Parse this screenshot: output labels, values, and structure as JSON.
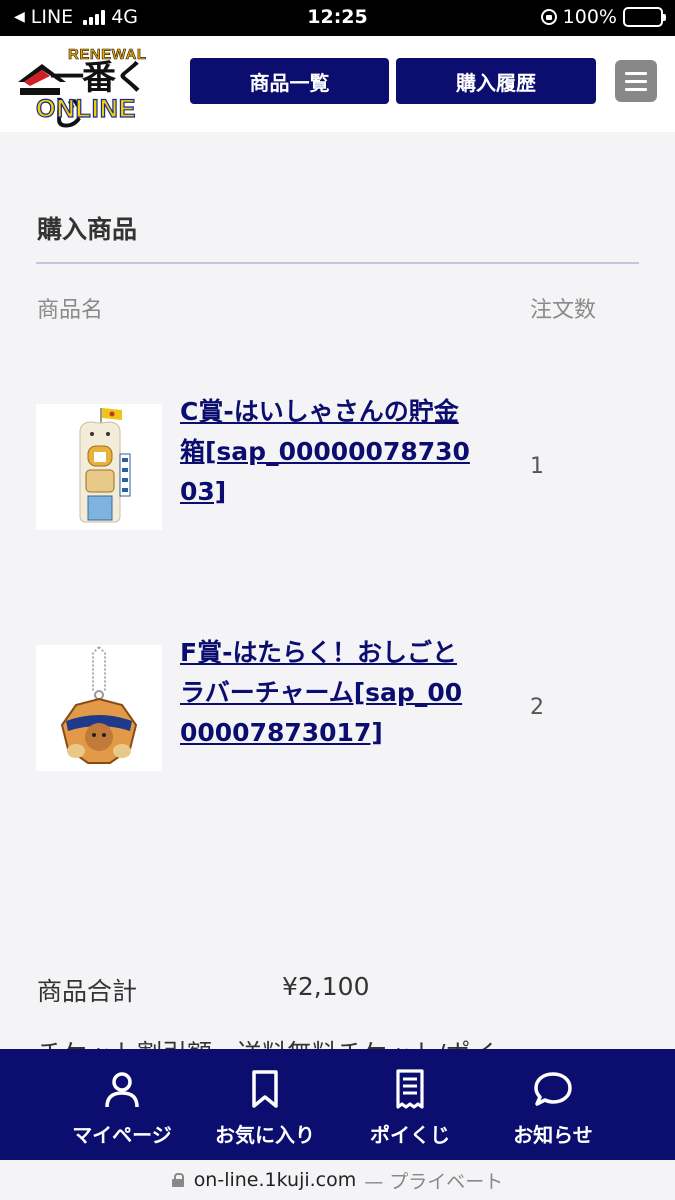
{
  "status_bar": {
    "back_label": "◀",
    "carrier": "LINE",
    "network": "4G",
    "time": "12:25",
    "battery": "100%"
  },
  "header": {
    "logo_renewal": "RENEWAL",
    "logo_main": "一番くじ",
    "logo_online": "ONLINE",
    "nav_products": "商品一覧",
    "nav_history": "購入履歴"
  },
  "main": {
    "section_title": "購入商品",
    "col_name": "商品名",
    "col_qty": "注文数",
    "items": [
      {
        "name": "C賞-はいしゃさんの貯金箱[sap_0000007873003]",
        "qty": "1",
        "thumb_icon": "piggy-bank-tooth-figure"
      },
      {
        "name": "F賞-はたらく！おしごとラバーチャーム[sap_0000007873017]",
        "qty": "2",
        "thumb_icon": "rubber-charm-keychain"
      }
    ],
    "summary_label": "商品合計",
    "summary_value": "¥2,100",
    "cut_line": "チケット割引額　送料無料チケット/ポイ..."
  },
  "bottom_nav": {
    "items": [
      {
        "label": "マイページ",
        "icon": "person-icon"
      },
      {
        "label": "お気に入り",
        "icon": "bookmark-icon"
      },
      {
        "label": "ポイくじ",
        "icon": "receipt-icon"
      },
      {
        "label": "お知らせ",
        "icon": "speech-bubble-icon"
      }
    ]
  },
  "url_bar": {
    "url": "on-line.1kuji.com",
    "suffix": "— プライベート"
  },
  "colors": {
    "navy": "#0b0e6f",
    "battery_green": "#4cd964",
    "logo_yellow": "#f4d000"
  }
}
